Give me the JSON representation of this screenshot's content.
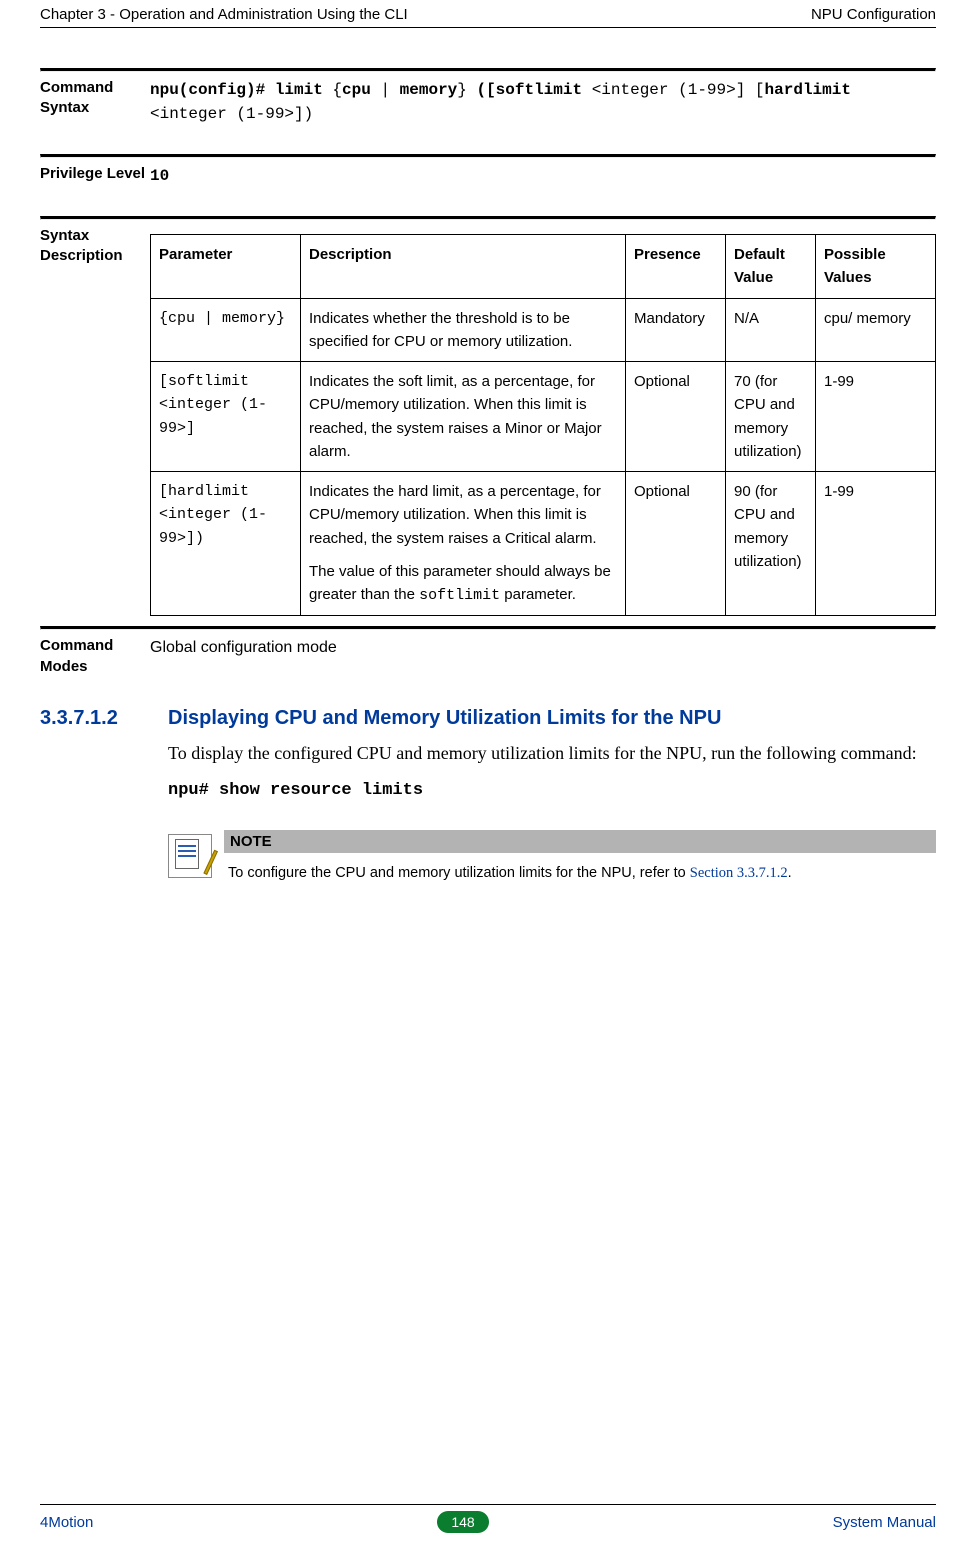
{
  "header": {
    "left": "Chapter 3 - Operation and Administration Using the CLI",
    "right": "NPU Configuration"
  },
  "command_syntax": {
    "label": "Command Syntax",
    "prefix_bold": "npu(config)# limit",
    "brace_open": " {",
    "p1_bold": "cpu",
    "pipe": " | ",
    "p2_bold": "memory",
    "brace_close": "} ",
    "paren_prefix": "([",
    "soft_bold": "softlimit",
    "soft_rest": " <integer (1-99>] [",
    "hard_bold": "hardlimit",
    "hard_rest": " <integer (1-99>])"
  },
  "privilege": {
    "label": "Privilege Level",
    "value": "10"
  },
  "syntax_desc": {
    "label": "Syntax Description",
    "headers": {
      "param": "Parameter",
      "desc": "Description",
      "presence": "Presence",
      "default": "Default Value",
      "possible": "Possible Values"
    },
    "rows": [
      {
        "param": "{cpu | memory}",
        "desc": "Indicates whether the threshold is to be specified for CPU or memory utilization.",
        "presence": "Mandatory",
        "default": "N/A",
        "possible": "cpu/ memory"
      },
      {
        "param": "[softlimit <integer (1-99>]",
        "desc": "Indicates the soft limit, as a percentage, for CPU/memory utilization. When this limit is reached, the system raises a Minor or Major alarm.",
        "presence": "Optional",
        "default": "70 (for CPU and memory utilization)",
        "possible": "1-99"
      },
      {
        "param": "[hardlimit <integer (1-99>])",
        "desc_p1": "Indicates the hard limit, as a percentage, for CPU/memory utilization. When this limit is reached, the system raises a Critical alarm.",
        "desc_p2a": "The value of this parameter should always be greater than the ",
        "desc_code": "softlimit",
        "desc_p2b": " parameter.",
        "presence": "Optional",
        "default": "90 (for CPU and memory utilization)",
        "possible": "1-99"
      }
    ]
  },
  "command_modes": {
    "label": "Command Modes",
    "value": "Global configuration mode"
  },
  "subsection": {
    "number": "3.3.7.1.2",
    "title": "Displaying CPU and Memory Utilization Limits for the NPU",
    "para": "To display the configured CPU and memory utilization limits for the NPU, run the following command:",
    "command": "npu# show resource limits"
  },
  "note": {
    "title": "NOTE",
    "text_prefix": "To configure the CPU and memory utilization limits for the NPU, refer to ",
    "link": "Section 3.3.7.1.2",
    "suffix": "."
  },
  "footer": {
    "left": "4Motion",
    "page": "148",
    "right": "System Manual"
  }
}
